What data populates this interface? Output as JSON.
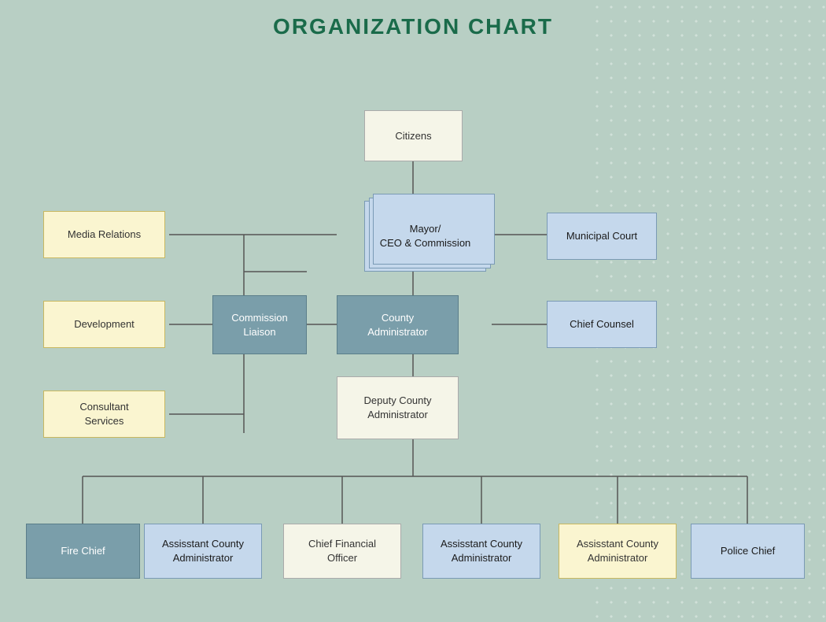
{
  "title": "ORGANIZATION CHART",
  "nodes": {
    "citizens": {
      "label": "Citizens"
    },
    "mayor": {
      "label": "Mayor/\nCEO & Commission"
    },
    "municipal_court": {
      "label": "Municipal Court"
    },
    "media_relations": {
      "label": "Media Relations"
    },
    "development": {
      "label": "Development"
    },
    "consultant_services": {
      "label": "Consultant\nServices"
    },
    "commission_liaison": {
      "label": "Commission\nLiaison"
    },
    "county_administrator": {
      "label": "County\nAdministrator"
    },
    "chief_counsel": {
      "label": "Chief Counsel"
    },
    "deputy_county_administrator": {
      "label": "Deputy County\nAdministrator"
    },
    "fire_chief": {
      "label": "Fire Chief"
    },
    "asst_county_admin_1": {
      "label": "Assisstant County\nAdministrator"
    },
    "chief_financial_officer": {
      "label": "Chief Financial\nOfficer"
    },
    "asst_county_admin_2": {
      "label": "Assisstant County\nAdministrator"
    },
    "asst_county_admin_3": {
      "label": "Assisstant County\nAdministrator"
    },
    "police_chief": {
      "label": "Police Chief"
    }
  }
}
